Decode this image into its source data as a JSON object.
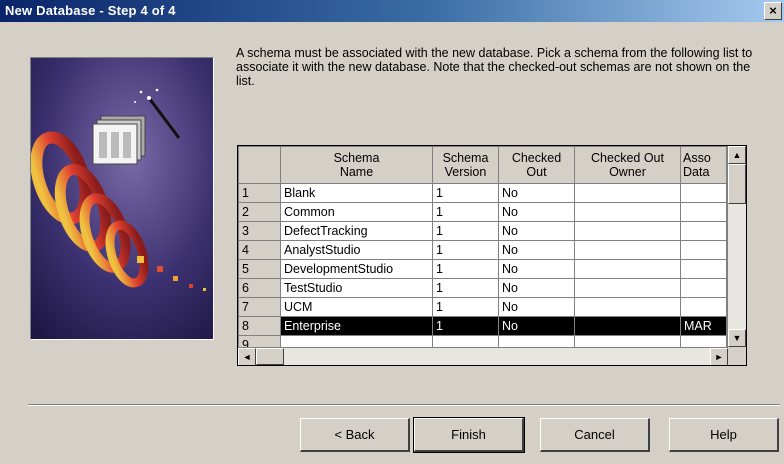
{
  "window": {
    "title": "New Database - Step 4 of 4",
    "close_glyph": "×"
  },
  "description": "A schema must be associated with the new database.  Pick a schema from the following list to associate it with the new database.  Note that the checked-out schemas are not shown on the list.",
  "grid": {
    "columns": [
      {
        "label": "Schema\nName"
      },
      {
        "label": "Schema\nVersion"
      },
      {
        "label": "Checked\nOut"
      },
      {
        "label": "Checked Out\nOwner"
      },
      {
        "label": "Asso\nData"
      }
    ],
    "rows": [
      {
        "num": "1",
        "name": "Blank",
        "version": "1",
        "checked_out": "No",
        "owner": "",
        "assoc": ""
      },
      {
        "num": "2",
        "name": "Common",
        "version": "1",
        "checked_out": "No",
        "owner": "",
        "assoc": ""
      },
      {
        "num": "3",
        "name": "DefectTracking",
        "version": "1",
        "checked_out": "No",
        "owner": "",
        "assoc": ""
      },
      {
        "num": "4",
        "name": "AnalystStudio",
        "version": "1",
        "checked_out": "No",
        "owner": "",
        "assoc": ""
      },
      {
        "num": "5",
        "name": "DevelopmentStudio",
        "version": "1",
        "checked_out": "No",
        "owner": "",
        "assoc": ""
      },
      {
        "num": "6",
        "name": "TestStudio",
        "version": "1",
        "checked_out": "No",
        "owner": "",
        "assoc": ""
      },
      {
        "num": "7",
        "name": "UCM",
        "version": "1",
        "checked_out": "No",
        "owner": "",
        "assoc": ""
      },
      {
        "num": "8",
        "name": "Enterprise",
        "version": "1",
        "checked_out": "No",
        "owner": "",
        "assoc": "MAR",
        "selected": true
      },
      {
        "num": "9",
        "name": "",
        "version": "",
        "checked_out": "",
        "owner": "",
        "assoc": ""
      }
    ]
  },
  "buttons": {
    "back": "< Back",
    "finish": "Finish",
    "cancel": "Cancel",
    "help": "Help"
  },
  "icons": {
    "scroll_up": "▲",
    "scroll_down": "▼",
    "scroll_left": "◄",
    "scroll_right": "►"
  }
}
